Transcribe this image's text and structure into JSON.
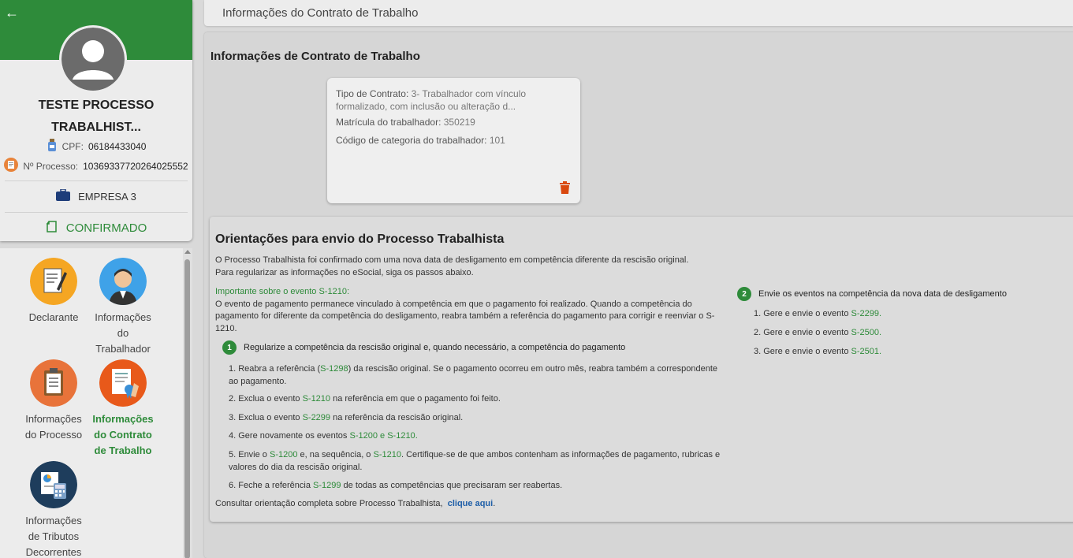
{
  "sidebar": {
    "back_icon": "arrow-left-icon",
    "profile": {
      "name_line1": "TESTE PROCESSO",
      "name_line2": "TRABALHIST...",
      "cpf_label": "CPF:",
      "cpf_value": "06184433040",
      "processo_label": "Nº Processo:",
      "processo_value": "10369337720264025552",
      "empresa": "EMPRESA 3",
      "status": "CONFIRMADO"
    },
    "menu": [
      {
        "line1": "Declarante",
        "line2": "",
        "line3": ""
      },
      {
        "line1": "Informações",
        "line2": "do",
        "line3": "Trabalhador"
      },
      {
        "line1": "Informações",
        "line2": "do Processo",
        "line3": ""
      },
      {
        "line1": "Informações",
        "line2": "do Contrato",
        "line3": "de Trabalho"
      },
      {
        "line1": "Informações",
        "line2": "de Tributos",
        "line3": "Decorrentes"
      }
    ]
  },
  "topbar": {
    "title": "Informações do Contrato de Trabalho"
  },
  "main": {
    "section_title": "Informações de Contrato de Trabalho",
    "contract": {
      "tipo_label": "Tipo de Contrato:",
      "tipo_value_line1": "3- Trabalhador com vínculo",
      "tipo_value_line2": "formalizado, com inclusão ou alteração d...",
      "matricula_label": "Matrícula do trabalhador:",
      "matricula_value": "350219",
      "categoria_label": "Código de categoria do trabalhador:",
      "categoria_value": "101"
    },
    "orientacoes": {
      "title": "Orientações para envio do Processo Trabalhista",
      "intro_line1": "O Processo Trabalhista foi confirmado com uma nova data de desligamento em competência diferente da rescisão original.",
      "intro_line2": "Para regularizar as informações no eSocial, siga os passos abaixo.",
      "important_title": "Importante sobre o evento S-1210:",
      "important_text": "O evento de pagamento permanece vinculado à competência em que o pagamento foi realizado. Quando a competência do pagamento for diferente da competência do desligamento, reabra também a referência do pagamento para corrigir e reenviar o S-1210.",
      "step1": {
        "num": "1",
        "title": "Regularize a competência da rescisão original e, quando necessário, a competência do pagamento",
        "i1a": "1. Reabra a referência (",
        "i1b": "S-1298",
        "i1c": ") da rescisão original. Se o pagamento ocorreu em outro mês, reabra também a correspondente ao pagamento.",
        "i2a": "2. Exclua o evento ",
        "i2b": "S-1210",
        "i2c": " na referência em que o pagamento foi feito.",
        "i3a": "3. Exclua o evento ",
        "i3b": "S-2299",
        "i3c": " na referência da rescisão original.",
        "i4a": "4. Gere novamente os eventos ",
        "i4b": "S-1200",
        "i4c": " e ",
        "i4d": "S-1210",
        "i4e": ".",
        "i5a": "5. Envie o ",
        "i5b": "S-1200",
        "i5c": " e, na sequência, o ",
        "i5d": "S-1210",
        "i5e": ". Certifique-se de que ambos contenham as informações de pagamento, rubricas e valores do dia da rescisão original.",
        "i6a": "6. Feche a referência ",
        "i6b": "S-1299",
        "i6c": " de todas as competências que precisaram ser reabertas."
      },
      "step2": {
        "num": "2",
        "title": "Envie os eventos na competência da nova data de desligamento",
        "i1a": "1. Gere e envie o evento ",
        "i1b": "S-2299",
        "i1c": ".",
        "i2a": "2. Gere e envie o evento ",
        "i2b": "S-2500",
        "i2c": ".",
        "i3a": "3. Gere e envie o evento ",
        "i3b": "S-2501",
        "i3c": "."
      },
      "footer_text": "Consultar orientação completa sobre Processo Trabalhista,",
      "footer_link": "clique aqui",
      "footer_end": "."
    }
  },
  "colors": {
    "header_green": "#2e8b3a",
    "link_blue": "#1f5fa8",
    "trash_orange": "#d9480f"
  }
}
